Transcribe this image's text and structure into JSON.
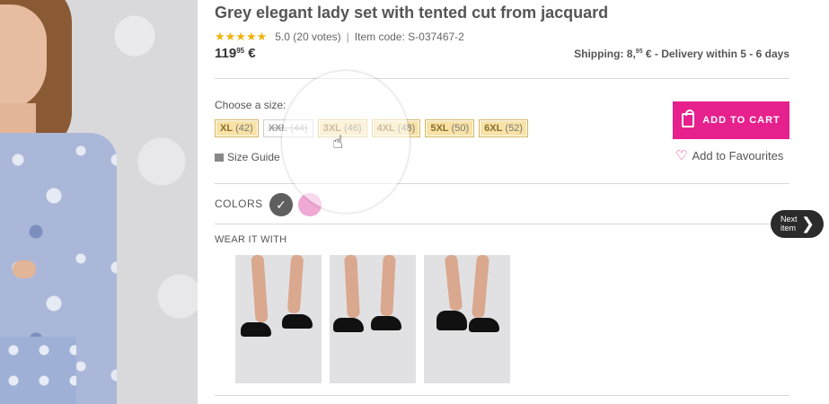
{
  "product": {
    "title": "Grey elegant lady set with tented cut from jacquard",
    "stars": "★★★★★",
    "rating": "5.0 (20 votes)",
    "item_code": "Item code: S-037467-2",
    "price_main": "119",
    "price_cents": "95",
    "price_currency": "€"
  },
  "shipping": {
    "label": "Shipping: 8,",
    "cents": "95",
    "rest": " € - Delivery within 5 - 6 days"
  },
  "sizes": {
    "label": "Choose a size:",
    "options": [
      {
        "size": "XL",
        "eu": "(42)"
      },
      {
        "size": "XXL",
        "eu": "(44)"
      },
      {
        "size": "3XL",
        "eu": "(46)"
      },
      {
        "size": "4XL",
        "eu": "(48)"
      },
      {
        "size": "5XL",
        "eu": "(50)"
      },
      {
        "size": "6XL",
        "eu": "(52)"
      }
    ],
    "guide": "Size Guide"
  },
  "actions": {
    "add_to_cart": "ADD TO CART",
    "favourites": "Add to Favourites"
  },
  "colors": {
    "label": "COLORS",
    "check": "✓",
    "swatches": [
      "#5f5f5f",
      "#f0a8d4"
    ]
  },
  "wear_with": {
    "label": "WEAR IT WITH"
  },
  "navigation": {
    "next_label": "Next item",
    "next_arrow": "❯"
  }
}
